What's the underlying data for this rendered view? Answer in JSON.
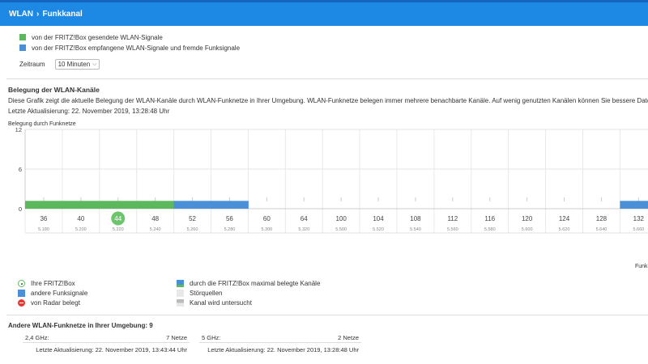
{
  "breadcrumb": {
    "parent": "WLAN",
    "current": "Funkkanal"
  },
  "legend_top": [
    {
      "label": "von der FRITZ!Box gesendete WLAN-Signale",
      "color": "#5cb85c"
    },
    {
      "label": "von der FRITZ!Box empfangene WLAN-Signale und fremde Funksignale",
      "color": "#4a90d9"
    }
  ],
  "zeitraum": {
    "label": "Zeitraum",
    "value": "10 Minuten"
  },
  "section": {
    "title": "Belegung der WLAN-Kanäle",
    "description": "Diese Grafik zeigt die aktuelle Belegung der WLAN-Kanäle durch WLAN-Funknetze in Ihrer Umgebung. WLAN-Funknetze belegen immer mehrere benachbarte Kanäle. Auf wenig genutzten Kanälen können Sie bessere Datendurch",
    "updated": "Letzte Aktualisierung: 22. November 2019, 13:28:48 Uhr",
    "chart_label": "Belegung durch Funknetze"
  },
  "chart_data": {
    "type": "bar",
    "y_ticks": [
      "12",
      "6",
      "0"
    ],
    "ylim": [
      0,
      12
    ],
    "channels": [
      "36",
      "40",
      "44",
      "48",
      "52",
      "56",
      "60",
      "64",
      "100",
      "104",
      "108",
      "112",
      "116",
      "120",
      "124",
      "128",
      "132"
    ],
    "frequencies": [
      "5.180",
      "5.200",
      "5.220",
      "5.240",
      "5.260",
      "5.280",
      "5.300",
      "5.320",
      "5.500",
      "5.520",
      "5.540",
      "5.560",
      "5.580",
      "5.600",
      "5.620",
      "5.640",
      "5.660"
    ],
    "own_channel": "44",
    "series": [
      {
        "values": [
          1,
          1,
          1,
          1,
          0,
          0,
          0,
          0,
          0,
          0,
          0,
          0,
          0,
          0,
          0,
          0,
          0
        ],
        "color": "#5cb85c"
      },
      {
        "values": [
          0,
          0,
          0,
          0,
          1,
          1,
          0,
          0,
          0,
          0,
          0,
          0,
          0,
          0,
          0,
          0,
          1
        ],
        "color": "#4a90d9"
      }
    ]
  },
  "funk_label": "Funk",
  "legend_bottom": {
    "own": "Ihre FRITZ!Box",
    "other": "andere Funksignale",
    "radar": "von Radar belegt",
    "max": "durch die FRITZ!Box maximal belegte Kanäle",
    "stoer": "Störquellen",
    "unt": "Kanal wird untersucht"
  },
  "other_networks": {
    "title": "Andere WLAN-Funknetze in Ihrer Umgebung: 9",
    "band24": {
      "label": "2,4 GHz:",
      "count": "7 Netze",
      "updated": "Letzte Aktualisierung: 22. November 2019, 13:43:44 Uhr"
    },
    "band5": {
      "label": "5 GHz:",
      "count": "2 Netze",
      "updated": "Letzte Aktualisierung: 22. November 2019, 13:28:48 Uhr"
    }
  }
}
